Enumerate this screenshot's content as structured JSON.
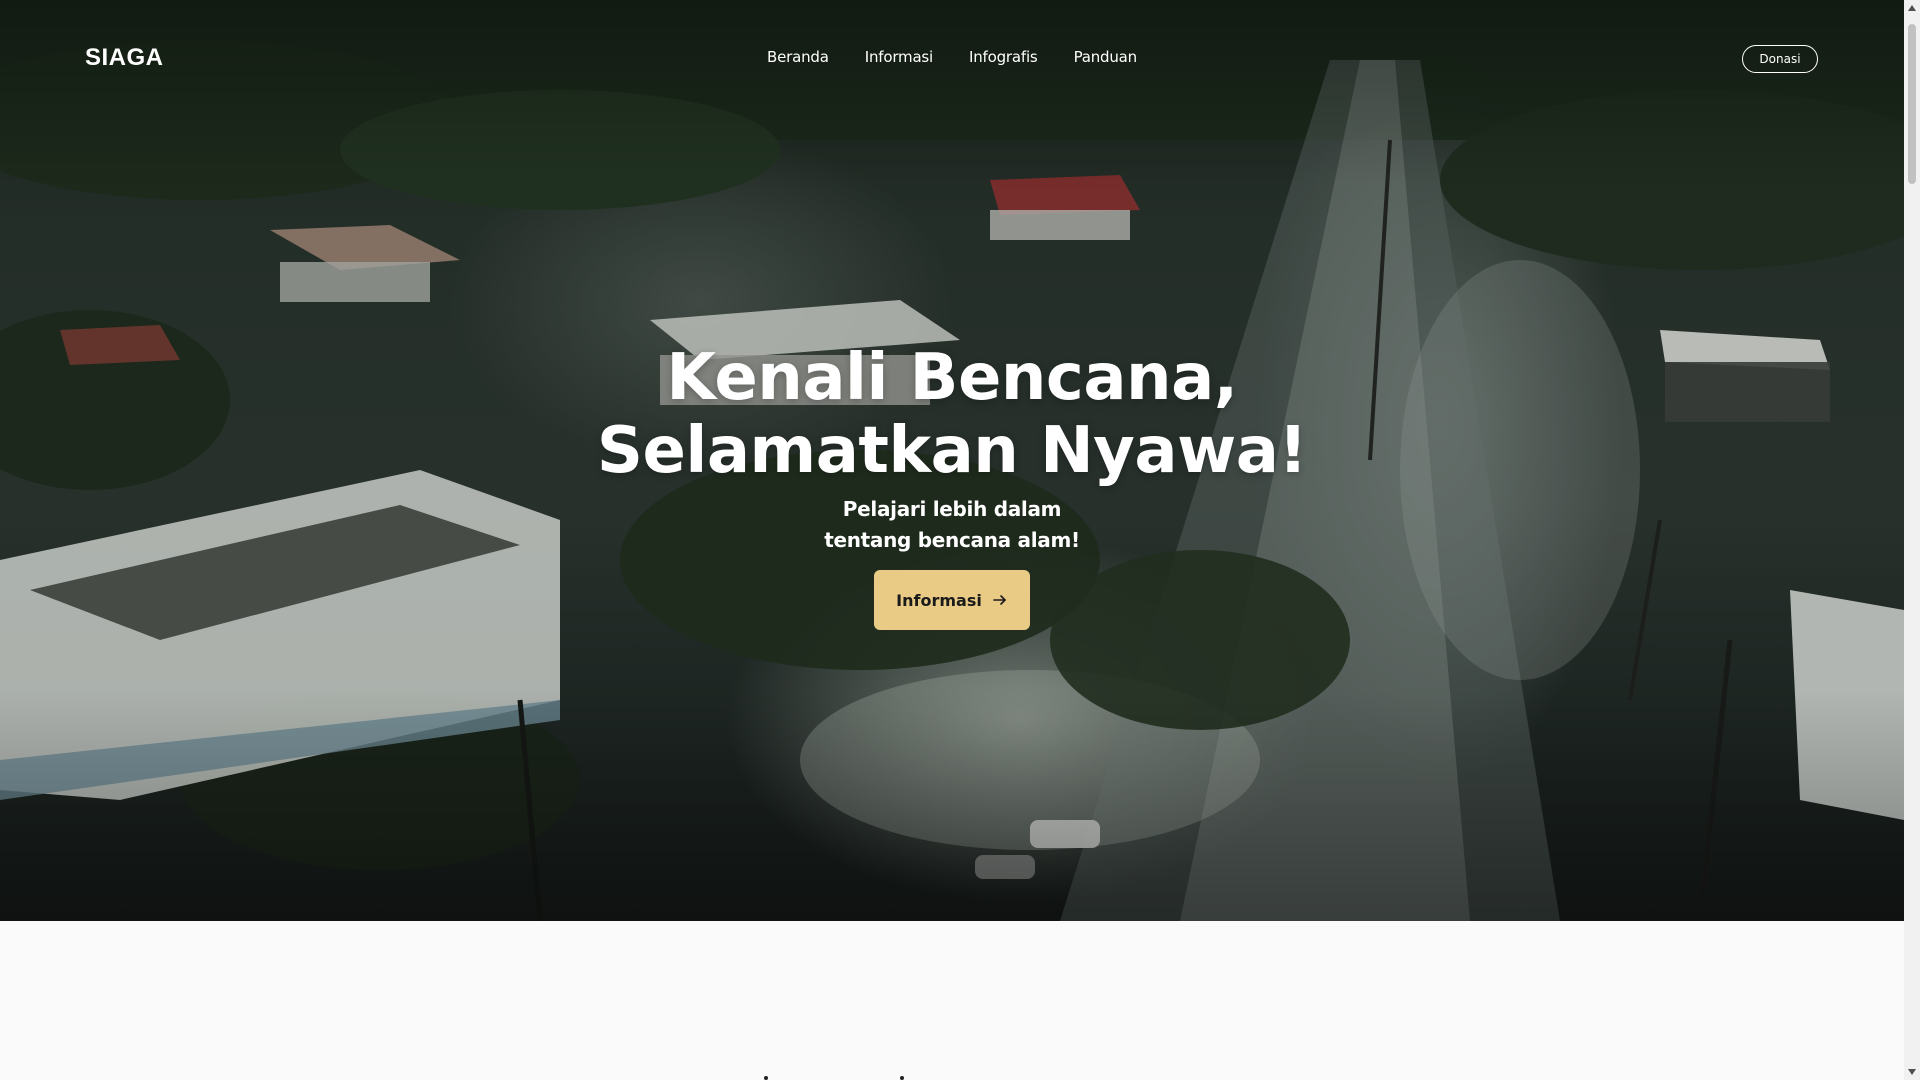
{
  "brand": {
    "name": "SIAGA"
  },
  "nav": {
    "items": [
      {
        "label": "Beranda"
      },
      {
        "label": "Informasi"
      },
      {
        "label": "Infografis"
      },
      {
        "label": "Panduan"
      }
    ],
    "donate_label": "Donasi"
  },
  "hero": {
    "title_line1": "Kenali Bencana,",
    "title_line2": "Selamatkan Nyawa!",
    "subtitle_line1": "Pelajari lebih dalam",
    "subtitle_line2": "tentang bencana alam!",
    "cta_label": "Informasi",
    "cta_icon": "arrow-right-icon",
    "background_image": "aerial view of a flooded town with submerged buildings and trees"
  },
  "colors": {
    "accent": "#e9cb86",
    "text_on_hero": "#ffffff",
    "page_bg": "#fafafa"
  }
}
